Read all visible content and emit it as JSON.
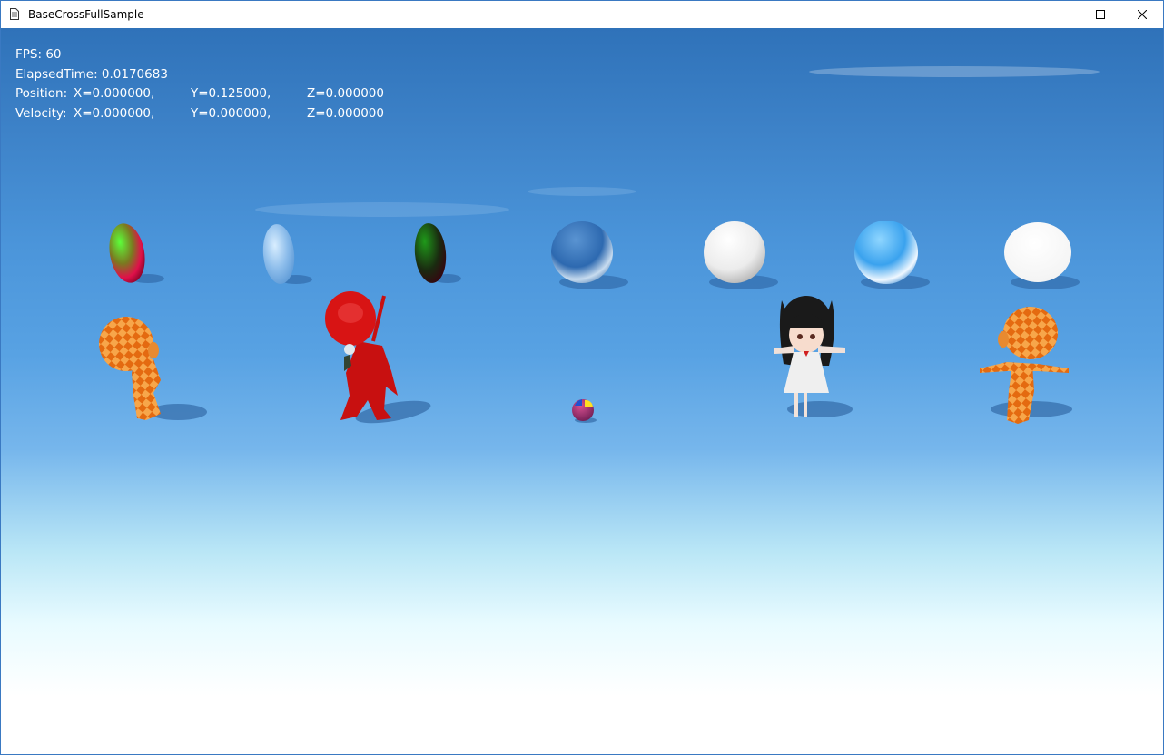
{
  "window": {
    "title": "BaseCrossFullSample",
    "icons": {
      "app": "document-icon",
      "minimize": "minimize-icon",
      "maximize": "maximize-icon",
      "close": "close-icon"
    }
  },
  "hud": {
    "fps": "FPS: 60",
    "elapsed": "ElapsedTime: 0.0170683",
    "position": {
      "label": "Position:",
      "x": "X=0.000000,",
      "y": "Y=0.125000,",
      "z": "Z=0.000000"
    },
    "velocity": {
      "label": "Velocity:",
      "x": "X=0.000000,",
      "y": "Y=0.000000,",
      "z": "Z=0.000000"
    }
  },
  "scene": {
    "spheres": [
      "normal-map-sphere",
      "glass-sky-sphere",
      "dark-normal-sphere",
      "blue-sky-sphere",
      "white-sphere",
      "bright-sky-sphere",
      "white-ellipsoid"
    ],
    "characters": [
      "orange-checker-character-left",
      "red-robot-character",
      "small-ball-player",
      "anime-girl-character",
      "orange-checker-character-right"
    ]
  }
}
